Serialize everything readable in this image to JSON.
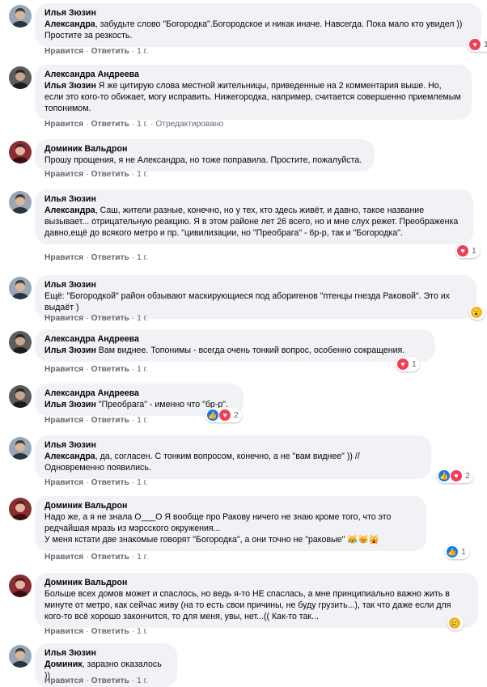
{
  "ui": {
    "like": "Нравится",
    "reply": "Ответить",
    "sep": "·"
  },
  "comments": [
    {
      "author": "Илья Зюзин",
      "mention": "Александра",
      "text": ", забудьте слово \"Богородка\".Богородское и никак иначе. Навсегда. Пока мало кто увидел )) Простите за резкость.",
      "time": "1 г.",
      "edited": "",
      "reactions": [
        "love"
      ],
      "count": "1",
      "avatar": "ilya"
    },
    {
      "author": "Александра Андреева",
      "mention": "Илья Зюзин",
      "text": " Я же цитирую слова местной жительницы, приведенные на 2 комментария выше. Но, если это кого-то обижает, могу исправить. Нижегородка, например, считается совершенно приемлемым топонимом.",
      "time": "1 г.",
      "edited": "Отредактировано",
      "reactions": [],
      "count": "",
      "avatar": "alex"
    },
    {
      "author": "Доминик Вальдрон",
      "mention": "",
      "text": "Прошу прощения, я не Александра, но тоже поправила. Простите, пожалуйста.",
      "time": "1 г.",
      "edited": "",
      "reactions": [],
      "count": "",
      "avatar": "dom"
    },
    {
      "author": "Илья Зюзин",
      "mention": "Александра",
      "text": ", Саш, жители разные, конечно, но у тех, кто здесь живёт, и давно, такое название вызывает... отрицательную реакцию. Я в этом районе лет 26 всего, но и мне слух режет. Преображенка давно,ещё до всякого метро и пр. \"цивилизации, но \"Преобрага\" - 6р-р, так и \"Богородка\".",
      "time": "1 г.",
      "edited": "",
      "reactions": [
        "love"
      ],
      "count": "1",
      "avatar": "ilya"
    },
    {
      "author": "Илья Зюзин",
      "mention": "",
      "text": "Ещё: \"Богородкой\" район обзывают маскирующиеся под аборигенов \"птенцы гнезда Раковой\". Это их выдаёт )",
      "time": "1 г.",
      "edited": "",
      "reactions": [
        "wow"
      ],
      "count": "",
      "avatar": "ilya"
    },
    {
      "author": "Александра Андреева",
      "mention": "Илья Зюзин",
      "text": " Вам виднее. Топонимы - всегда очень тонкий вопрос, особенно сокращения.",
      "time": "1 г.",
      "edited": "",
      "reactions": [
        "love"
      ],
      "count": "1",
      "avatar": "alex"
    },
    {
      "author": "Александра Андреева",
      "mention": "Илья Зюзин",
      "text": " \"Преобрага\" - именно что \"бр-р\".",
      "time": "1 г.",
      "edited": "",
      "reactions": [
        "like",
        "love"
      ],
      "count": "2",
      "avatar": "alex"
    },
    {
      "author": "Илья Зюзин",
      "mention": "Александра",
      "text": ", да, согласен. С тонким вопросом, конечно, а не \"вам виднее\" )) // Одновременно появились.",
      "time": "1 г.",
      "edited": "",
      "reactions": [
        "like",
        "love"
      ],
      "count": "2",
      "avatar": "ilya"
    },
    {
      "author": "Доминик Вальдрон",
      "mention": "",
      "text": "Надо же, а я не знала О___О Я вообще про Ракову ничего не знаю кроме того, что это редчайшая мразь из мэрсского окружения...\nУ меня кстати две знакомые говорят \"Богородка\", а они точно не \"раковые\" 😹😸🙀",
      "time": "1 г.",
      "edited": "",
      "reactions": [
        "like"
      ],
      "count": "1",
      "avatar": "dom"
    },
    {
      "author": "Доминик Вальдрон",
      "mention": "",
      "text": "Больше всех домов может и спаслось, но ведь я-то НЕ спаслась, а мне принципиально важно жить в минуте от метро, как сейчас живу (на то есть свои причины, не буду грузить...), так что даже если для кого-то всё хорошо закончится, то для меня, увы, нет...(( Как-то так...",
      "time": "1 г.",
      "edited": "",
      "reactions": [
        "sad"
      ],
      "count": "",
      "avatar": "dom"
    },
    {
      "author": "Илья Зюзин",
      "mention": "Доминик",
      "text": ", заразно оказалось ))",
      "time": "1 г.",
      "edited": "",
      "reactions": [],
      "count": "",
      "avatar": "ilya"
    }
  ]
}
